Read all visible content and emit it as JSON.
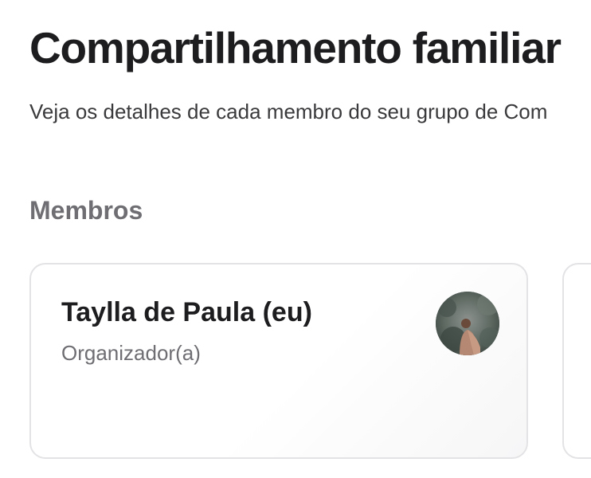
{
  "page": {
    "title": "Compartilhamento familiar",
    "subtitle": "Veja os detalhes de cada membro do seu grupo de Com"
  },
  "members_section": {
    "heading": "Membros",
    "members": [
      {
        "name": "Taylla de Paula (eu)",
        "role": "Organizador(a)",
        "avatar_icon": "profile-photo"
      }
    ]
  },
  "colors": {
    "title_text": "#1d1d1f",
    "secondary_text": "#6e6e73",
    "card_border": "#e3e3e6",
    "background": "#ffffff"
  }
}
